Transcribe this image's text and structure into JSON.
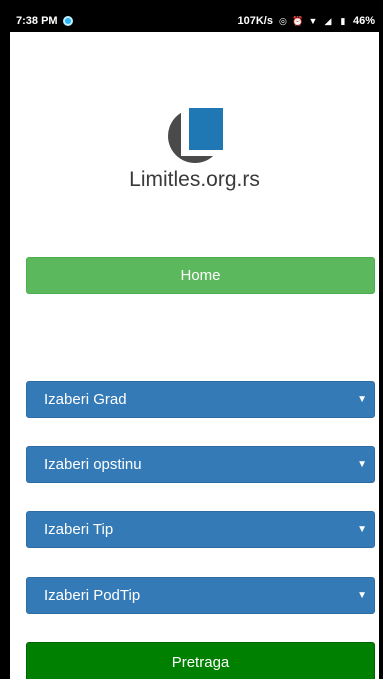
{
  "status_bar": {
    "time": "7:38 PM",
    "speed": "107K/s",
    "battery": "46%"
  },
  "logo": {
    "text": "Limitles.org.rs"
  },
  "nav": {
    "home_label": "Home"
  },
  "filters": {
    "city": "Izaberi Grad",
    "municipality": "Izaberi opstinu",
    "type": "Izaberi Tip",
    "subtype": "Izaberi PodTip"
  },
  "actions": {
    "search_label": "Pretraga"
  },
  "colors": {
    "home_button": "#5cb85c",
    "select": "#337ab7",
    "search_button": "#008000",
    "logo_blue": "#1f77b4",
    "logo_gray": "#4a4a4a"
  }
}
